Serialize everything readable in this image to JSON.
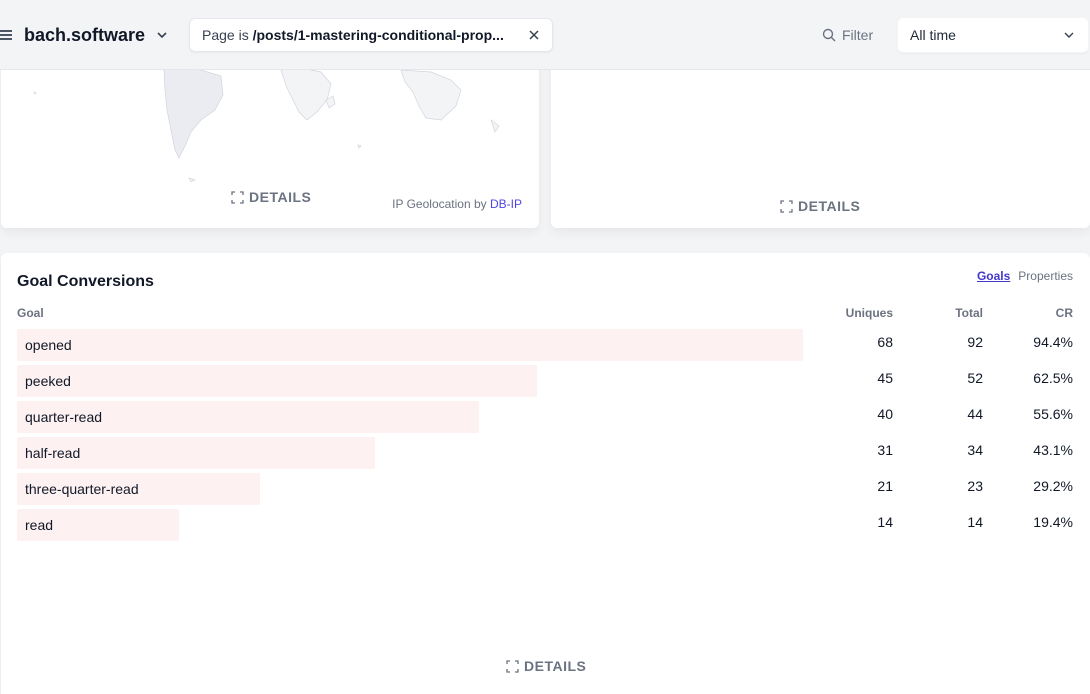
{
  "header": {
    "site_name": "bach.software",
    "filter_prefix": "Page is ",
    "filter_value": "/posts/1-mastering-conditional-prop...",
    "filter_label": "Filter",
    "period": "All time"
  },
  "map_card": {
    "details_label": "DETAILS",
    "geo_prefix": "IP Geolocation by ",
    "geo_link": "DB-IP"
  },
  "right_card": {
    "details_label": "DETAILS"
  },
  "goals": {
    "title": "Goal Conversions",
    "tabs": [
      "Goals",
      "Properties"
    ],
    "columns": {
      "goal": "Goal",
      "uniques": "Uniques",
      "total": "Total",
      "cr": "CR"
    },
    "rows": [
      {
        "goal": "opened",
        "uniques": "68",
        "total": "92",
        "cr": "94.4%",
        "bar": 1.0
      },
      {
        "goal": "peeked",
        "uniques": "45",
        "total": "52",
        "cr": "62.5%",
        "bar": 0.662
      },
      {
        "goal": "quarter-read",
        "uniques": "40",
        "total": "44",
        "cr": "55.6%",
        "bar": 0.588
      },
      {
        "goal": "half-read",
        "uniques": "31",
        "total": "34",
        "cr": "43.1%",
        "bar": 0.456
      },
      {
        "goal": "three-quarter-read",
        "uniques": "21",
        "total": "23",
        "cr": "29.2%",
        "bar": 0.309
      },
      {
        "goal": "read",
        "uniques": "14",
        "total": "14",
        "cr": "19.4%",
        "bar": 0.206
      }
    ],
    "details_label": "DETAILS"
  },
  "colors": {
    "bar": "#fdf1f1",
    "accent": "#4338ca",
    "link": "#4f46e5"
  }
}
